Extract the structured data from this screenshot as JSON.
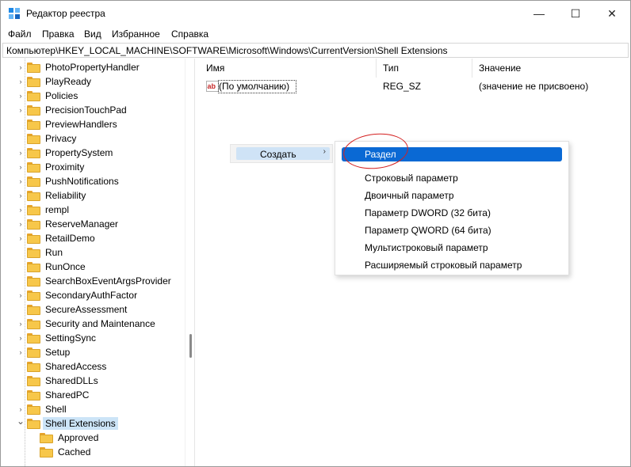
{
  "window": {
    "title": "Редактор реестра",
    "controls": {
      "minimize": "—",
      "maximize": "☐",
      "close": "✕"
    }
  },
  "menu": [
    "Файл",
    "Правка",
    "Вид",
    "Избранное",
    "Справка"
  ],
  "address": "Компьютер\\HKEY_LOCAL_MACHINE\\SOFTWARE\\Microsoft\\Windows\\CurrentVersion\\Shell Extensions",
  "tree": {
    "items": [
      {
        "label": "PhotoPropertyHandler",
        "expandable": true
      },
      {
        "label": "PlayReady",
        "expandable": true
      },
      {
        "label": "Policies",
        "expandable": true
      },
      {
        "label": "PrecisionTouchPad",
        "expandable": true
      },
      {
        "label": "PreviewHandlers",
        "expandable": false
      },
      {
        "label": "Privacy",
        "expandable": false
      },
      {
        "label": "PropertySystem",
        "expandable": true
      },
      {
        "label": "Proximity",
        "expandable": true
      },
      {
        "label": "PushNotifications",
        "expandable": true
      },
      {
        "label": "Reliability",
        "expandable": true
      },
      {
        "label": "rempl",
        "expandable": true
      },
      {
        "label": "ReserveManager",
        "expandable": true
      },
      {
        "label": "RetailDemo",
        "expandable": true
      },
      {
        "label": "Run",
        "expandable": false
      },
      {
        "label": "RunOnce",
        "expandable": false
      },
      {
        "label": "SearchBoxEventArgsProvider",
        "expandable": false
      },
      {
        "label": "SecondaryAuthFactor",
        "expandable": true
      },
      {
        "label": "SecureAssessment",
        "expandable": false
      },
      {
        "label": "Security and Maintenance",
        "expandable": true
      },
      {
        "label": "SettingSync",
        "expandable": true
      },
      {
        "label": "Setup",
        "expandable": true
      },
      {
        "label": "SharedAccess",
        "expandable": false
      },
      {
        "label": "SharedDLLs",
        "expandable": false
      },
      {
        "label": "SharedPC",
        "expandable": false
      },
      {
        "label": "Shell",
        "expandable": true
      },
      {
        "label": "Shell Extensions",
        "expandable": true,
        "expanded": true,
        "selected": true
      },
      {
        "label": "Approved",
        "expandable": false,
        "child": true
      },
      {
        "label": "Cached",
        "expandable": false,
        "child": true
      }
    ]
  },
  "list": {
    "columns": [
      "Имя",
      "Тип",
      "Значение"
    ],
    "rows": [
      {
        "name": "(По умолчанию)",
        "type": "REG_SZ",
        "value": "(значение не присвоено)",
        "icon": "string-value-icon"
      }
    ]
  },
  "context_menu": {
    "parent_label": "Создать",
    "items": [
      {
        "label": "Раздел",
        "selected": true
      },
      {
        "label": "Строковый параметр"
      },
      {
        "label": "Двоичный параметр"
      },
      {
        "label": "Параметр DWORD (32 бита)"
      },
      {
        "label": "Параметр QWORD (64 бита)"
      },
      {
        "label": "Мультистроковый параметр"
      },
      {
        "label": "Расширяемый строковый параметр"
      }
    ]
  },
  "colors": {
    "selection": "#0a69d4",
    "annotation": "#d42020",
    "folder": "#f7c74a"
  }
}
